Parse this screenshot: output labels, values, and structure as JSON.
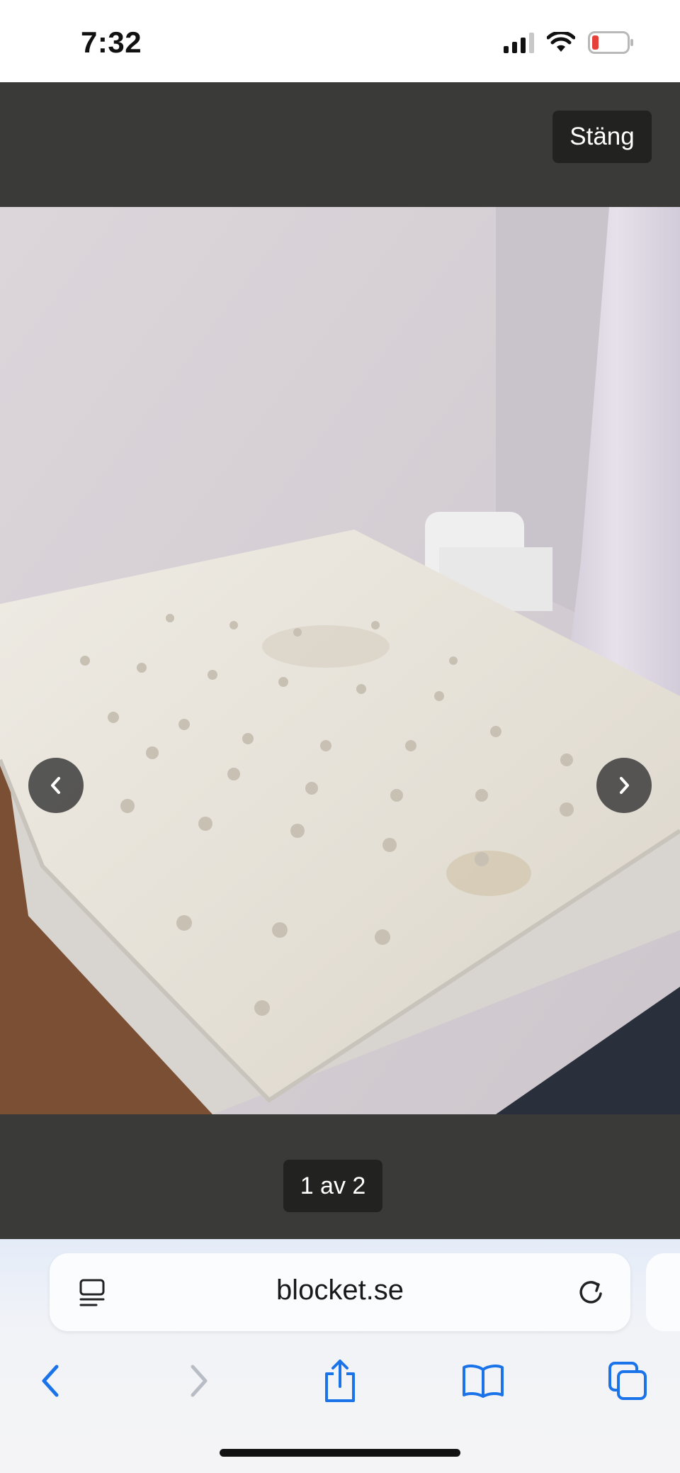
{
  "status_bar": {
    "time": "7:32",
    "icons": [
      "cellular-signal-icon",
      "wifi-icon",
      "battery-low-icon"
    ],
    "battery_color": "#e5413a"
  },
  "viewer": {
    "close_label": "Stäng",
    "counter": "1 av 2",
    "photo_subject": "mattress",
    "prev_icon": "chevron-left-icon",
    "next_icon": "chevron-right-icon"
  },
  "browser": {
    "url": "blocket.se",
    "accent": "#1a73e8",
    "toolbar": [
      "back-icon",
      "forward-icon",
      "share-icon",
      "bookmarks-icon",
      "tabs-icon"
    ]
  }
}
